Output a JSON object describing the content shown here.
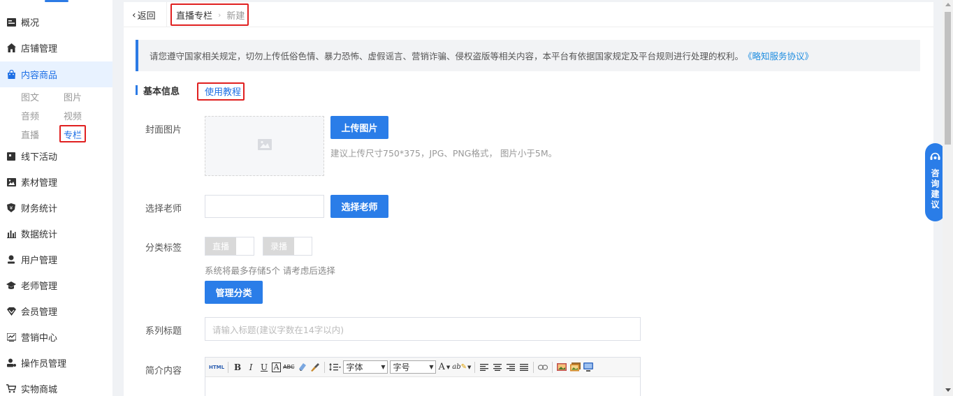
{
  "sidebar": {
    "items": [
      {
        "label": "概况",
        "icon": "dashboard-icon"
      },
      {
        "label": "店铺管理",
        "icon": "home-icon"
      },
      {
        "label": "内容商品",
        "icon": "shopping-bag-icon"
      },
      {
        "label": "线下活动",
        "icon": "calendar-icon"
      },
      {
        "label": "素材管理",
        "icon": "image-icon"
      },
      {
        "label": "财务统计",
        "icon": "shield-icon"
      },
      {
        "label": "数据统计",
        "icon": "bar-chart-icon"
      },
      {
        "label": "用户管理",
        "icon": "user-icon"
      },
      {
        "label": "老师管理",
        "icon": "graduation-cap-icon"
      },
      {
        "label": "会员管理",
        "icon": "vip-icon"
      },
      {
        "label": "营销中心",
        "icon": "trend-icon"
      },
      {
        "label": "操作员管理",
        "icon": "operator-icon"
      },
      {
        "label": "实物商城",
        "icon": "cart-icon"
      }
    ],
    "sub_items": [
      "图文",
      "图片",
      "音频",
      "视频",
      "直播",
      "专栏"
    ]
  },
  "topbar": {
    "back_label": "返回",
    "crumb_parent": "直播专栏",
    "crumb_current": "新建"
  },
  "notice": {
    "text": "请您遵守国家相关规定，切勿上传低俗色情、暴力恐怖、虚假谣言、营销诈骗、侵权盗版等相关内容，本平台有依据国家规定及平台规则进行处理的权利。",
    "link": "《略知服务协议》"
  },
  "section": {
    "title": "基本信息",
    "tutorial_link": "使用教程"
  },
  "form": {
    "cover_label": "封面图片",
    "upload_button": "上传图片",
    "upload_hint": "建议上传尺寸750*375，JPG、PNG格式， 图片小于5M。",
    "teacher_label": "选择老师",
    "teacher_button": "选择老师",
    "category_label": "分类标签",
    "tags": [
      "直播",
      "录播"
    ],
    "category_hint": "系统将最多存储5个 请考虑后选择",
    "manage_button": "管理分类",
    "title_label": "系列标题",
    "title_placeholder": "请输入标题(建议字数在14字以内)",
    "intro_label": "简介内容"
  },
  "editor": {
    "html_btn": "HTML",
    "bold": "B",
    "italic": "I",
    "underline": "U",
    "fontcolor_box": "A",
    "strike": "ABC",
    "font_select": "字体",
    "size_select": "字号",
    "font_color": "A",
    "highlight": "ab"
  },
  "consult": {
    "label": "咨询建议"
  },
  "colors": {
    "primary": "#2a7de8",
    "highlight_box": "#e02020",
    "active_nav_bg": "#e8f2ff"
  }
}
